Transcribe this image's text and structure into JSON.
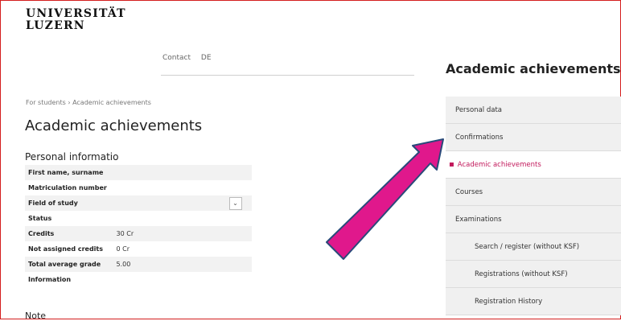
{
  "logo": {
    "line1": "UNIVERSITÄT",
    "line2": "LUZERN"
  },
  "topnav": {
    "contact": "Contact",
    "lang": "DE"
  },
  "breadcrumb": "For students › Academic achievements",
  "main_title": "Academic achievements",
  "section_title": "Personal informatio",
  "info_rows": [
    {
      "label": "First name, surname",
      "value": ""
    },
    {
      "label": "Matriculation number",
      "value": ""
    },
    {
      "label": "Field of study",
      "value": ""
    },
    {
      "label": "Status",
      "value": ""
    },
    {
      "label": "Credits",
      "value": "30 Cr"
    },
    {
      "label": "Not assigned credits",
      "value": "0 Cr"
    },
    {
      "label": "Total average grade",
      "value": "5.00"
    },
    {
      "label": "Information",
      "value": ""
    }
  ],
  "select_icon": "chevron-down-icon",
  "note": "Note",
  "sidebar": {
    "title": "Academic achievements",
    "items": [
      {
        "label": "Personal data"
      },
      {
        "label": "Confirmations"
      },
      {
        "label": "Academic achievements",
        "active": true
      },
      {
        "label": "Courses"
      },
      {
        "label": "Examinations"
      },
      {
        "label": "Search / register (without KSF)",
        "sub": true
      },
      {
        "label": "Registrations (without KSF)",
        "sub": true
      },
      {
        "label": "Registration History",
        "sub": true
      }
    ]
  },
  "colors": {
    "frame": "#d41e1e",
    "arrow": "#e0188c",
    "arrow_outline": "#2a4a7a",
    "active": "#c2185b"
  }
}
